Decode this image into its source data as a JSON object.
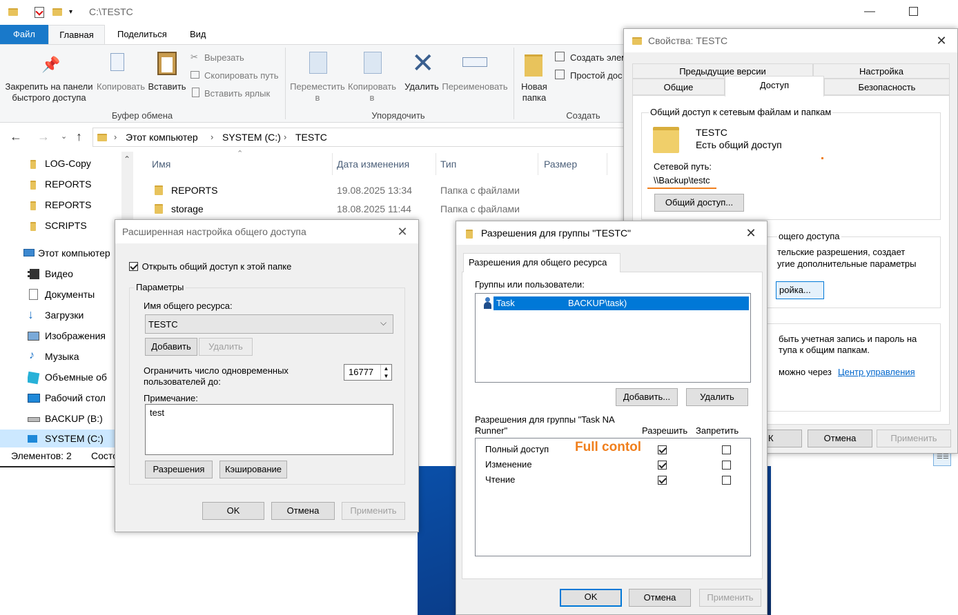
{
  "explorer": {
    "title": "C:\\TESTC",
    "tabs": [
      "Файл",
      "Главная",
      "Поделиться",
      "Вид"
    ],
    "ribbon": {
      "pin": "Закрепить на панели\nбыстрого доступа",
      "copy": "Копировать",
      "paste": "Вставить",
      "cut": "Вырезать",
      "copy_path": "Скопировать путь",
      "paste_shortcut": "Вставить ярлык",
      "group_clipboard": "Буфер обмена",
      "move_to": "Переместить\nв",
      "copy_to": "Копировать\nв",
      "delete": "Удалить",
      "rename": "Переименовать",
      "group_organize": "Упорядочить",
      "new_folder": "Новая\nпапка",
      "new_item": "Создать элем",
      "easy_access": "Простой дос",
      "group_create": "Создать"
    },
    "breadcrumb": [
      "Этот компьютер",
      "SYSTEM (C:)",
      "TESTC"
    ],
    "sidebar": [
      "LOG-Copy",
      "REPORTS",
      "REPORTS",
      "SCRIPTS",
      "Этот компьютер",
      "Видео",
      "Документы",
      "Загрузки",
      "Изображения",
      "Музыка",
      "Объемные об",
      "Рабочий стол",
      "BACKUP (B:)",
      "SYSTEM (C:)"
    ],
    "columns": [
      "Имя",
      "Дата изменения",
      "Тип",
      "Размер"
    ],
    "files": [
      {
        "name": "REPORTS",
        "date": "19.08.2025 13:34",
        "type": "Папка с файлами"
      },
      {
        "name": "storage",
        "date": "18.08.2025 11:44",
        "type": "Папка с файлами"
      }
    ],
    "status_items": "Элементов: 2",
    "status_state": "Состо"
  },
  "props": {
    "title": "Свойства: TESTC",
    "tabs_top": [
      "Предыдущие версии",
      "Настройка"
    ],
    "tabs_bottom": [
      "Общие",
      "Доступ",
      "Безопасность"
    ],
    "group1_title": "Общий доступ к сетевым файлам и папкам",
    "share_name": "TESTC",
    "share_state": "Есть общий доступ",
    "path_label": "Сетевой путь:",
    "path_value": "\\\\Backup\\testc",
    "share_button": "Общий доступ...",
    "group2_title": "ощего доступа",
    "group2_line1": "тельские разрешения, создает",
    "group2_line2": "угие дополнительные параметры",
    "advanced_button": "ройка...",
    "group3_line1": "быть учетная запись и пароль на",
    "group3_line2": "тупа к общим папкам.",
    "group3_line3": "можно через",
    "control_link": "Центр управления",
    "ok": "К",
    "cancel": "Отмена",
    "apply": "Применить"
  },
  "adv": {
    "title": "Расширенная настройка общего доступа",
    "share_checkbox": "Открыть общий доступ к этой папке",
    "params_title": "Параметры",
    "share_name_label": "Имя общего ресурса:",
    "share_name_value": "TESTC",
    "add": "Добавить",
    "remove": "Удалить",
    "limit_label_1": "Ограничить число одновременных",
    "limit_label_2": "пользователей до:",
    "limit_value": "16777",
    "comment_label": "Примечание:",
    "comment_value": "test",
    "permissions": "Разрешения",
    "caching": "Кэширование",
    "ok": "OK",
    "cancel": "Отмена",
    "apply": "Применить"
  },
  "perm": {
    "title": "Разрешения для группы \"TESTC\"",
    "tab": "Разрешения для общего ресурса",
    "groups_label": "Группы или пользователи:",
    "user_name": "Task",
    "user_account": "BACKUP\\task)",
    "add": "Добавить...",
    "remove": "Удалить",
    "perm_label_1": "Разрешения для группы \"Task NA",
    "perm_label_2": "Runner\"",
    "allow": "Разрешить",
    "deny": "Запретить",
    "rows": [
      {
        "name": "Полный доступ",
        "allow": true,
        "deny": false
      },
      {
        "name": "Изменение",
        "allow": true,
        "deny": false
      },
      {
        "name": "Чтение",
        "allow": true,
        "deny": false
      }
    ],
    "annotation": "Full contol",
    "ok": "OK",
    "cancel": "Отмена",
    "apply": "Применить"
  },
  "colors": {
    "accent": "#0078d7",
    "annotation": "#f07f1d",
    "selection": "#0078d7"
  }
}
